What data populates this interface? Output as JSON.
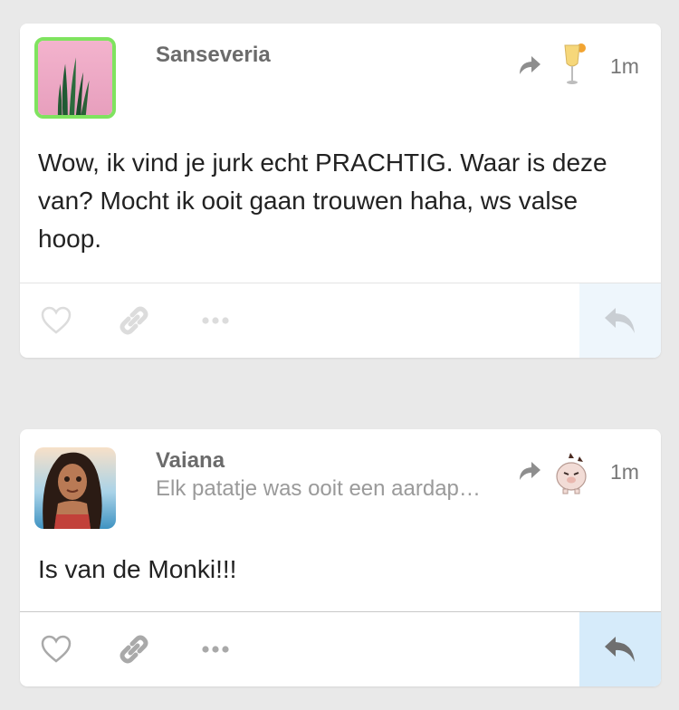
{
  "posts": [
    {
      "author": "Sanseveria",
      "subtitle": "",
      "time": "1m",
      "body": "Wow, ik vind je jurk echt PRACHTIG. Waar is deze van? Mocht ik ooit gaan trouwen haha, ws valse hoop.",
      "avatar_icon": "snake-plant-avatar",
      "source_icon": "champagne-glass-avatar",
      "avatar_border": "#7fe35f",
      "reply_bg": "#eef6fc"
    },
    {
      "author": "Vaiana",
      "subtitle": "Elk patatje was ooit een aardap…",
      "time": "1m",
      "body": "Is van de Monki!!!",
      "avatar_icon": "moana-avatar",
      "source_icon": "piggy-character-avatar",
      "reply_bg": "#d6ebfa"
    }
  ],
  "actions": [
    "heart-icon",
    "link-icon",
    "more-icon",
    "reply-icon"
  ],
  "colors": {
    "background": "#e9e9e9",
    "card": "#ffffff",
    "text": "#222222",
    "muted": "#9a9a9a"
  }
}
